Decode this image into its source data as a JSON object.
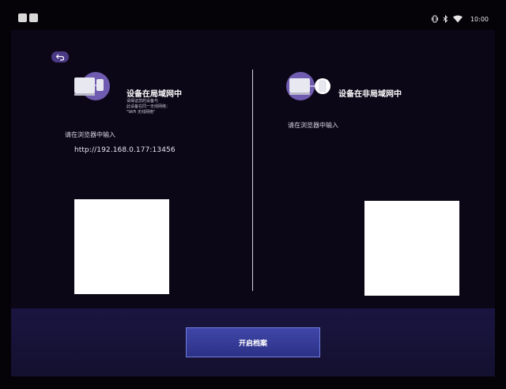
{
  "status_bar": {
    "time": "10:00"
  },
  "left_card": {
    "title": "设备在局域网中",
    "hint_lines": [
      "请保证您的设备与",
      "此设备在同一无线网络：",
      "\"WiFi 无线网络\""
    ],
    "prompt": "请在浏览器中输入",
    "url": "http://192.168.0.177:13456"
  },
  "right_card": {
    "title": "设备在非局域网中",
    "prompt": "请在浏览器中输入"
  },
  "action_button_label": "开启档案"
}
